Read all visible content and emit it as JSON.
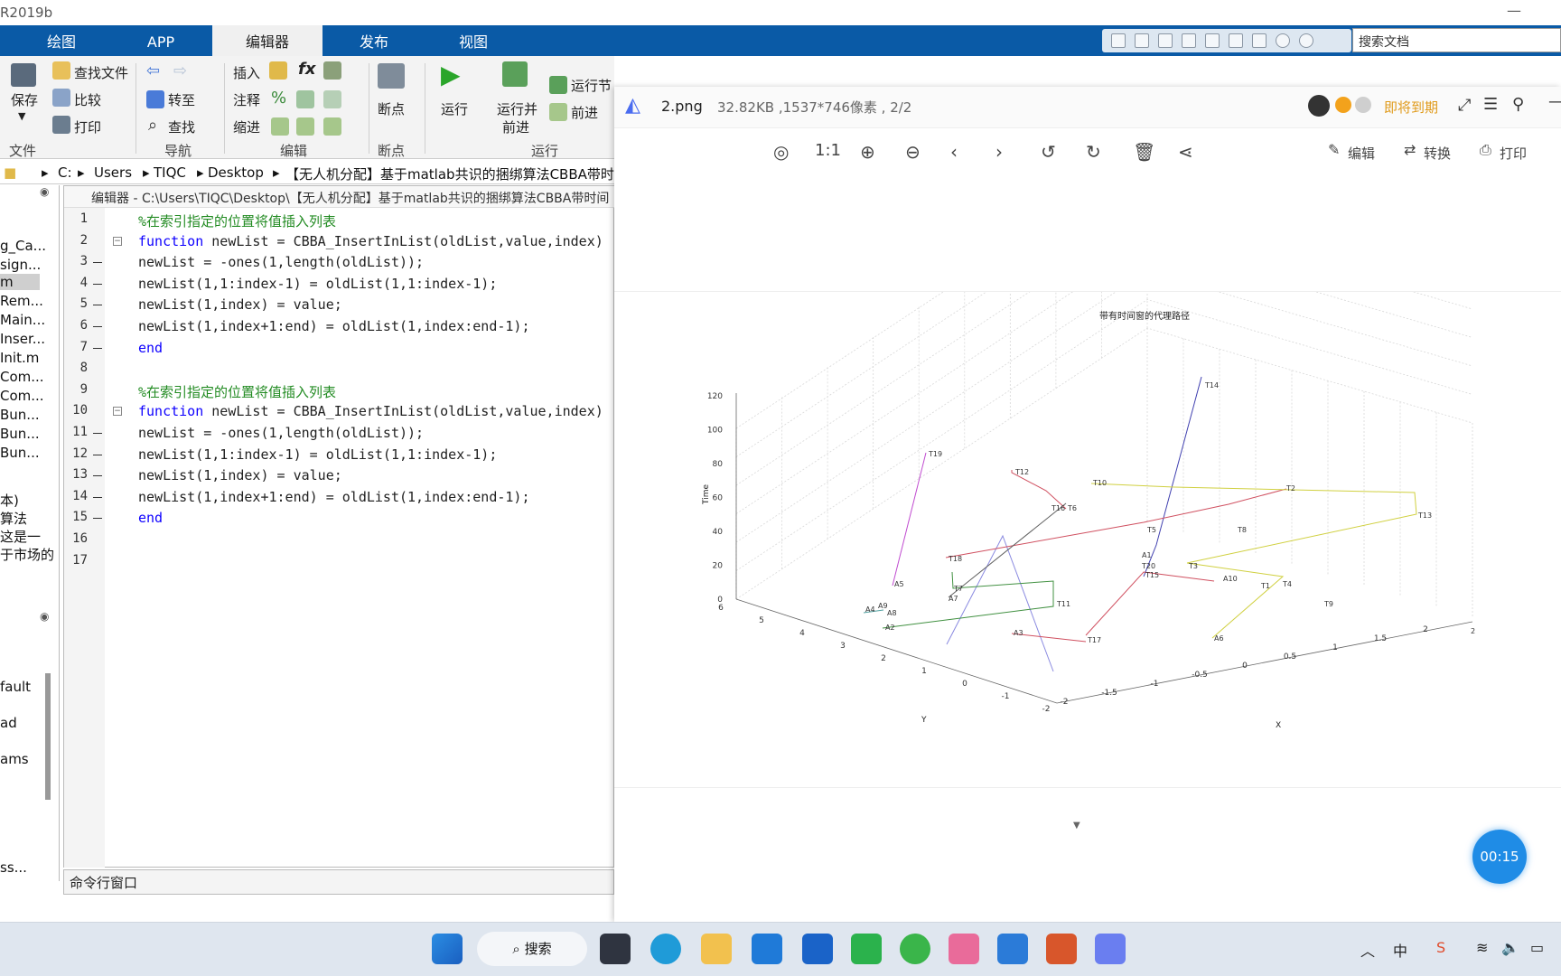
{
  "window": {
    "title_fragment": "R2019b"
  },
  "tabs": [
    "绘图",
    "APP",
    "编辑器",
    "发布",
    "视图"
  ],
  "search_doc_placeholder": "搜索文档",
  "ribbon": {
    "save": "保存",
    "find_file": "查找文件",
    "compare": "比较",
    "print": "打印",
    "goto": "转至",
    "find": "查找",
    "insert": "插入",
    "fx": "fx",
    "comment": "注释",
    "indent": "缩进",
    "breakpoints": "断点",
    "run": "运行",
    "run_advance_1": "运行并",
    "run_advance_2": "前进",
    "run_section": "运行节",
    "advance": "前进",
    "sections": {
      "file": "文件",
      "navigate": "导航",
      "edit": "编辑",
      "breakpoints": "断点",
      "run": "运行"
    }
  },
  "path": [
    "C:",
    "Users",
    "TIQC",
    "Desktop",
    "【无人机分配】基于matlab共识的捆绑算法CBBA带时间"
  ],
  "left_files": [
    "g_Ca...",
    "sign...",
    "m",
    "Rem...",
    "Main...",
    "Inser...",
    "Init.m",
    "Com...",
    "Com...",
    "Bun...",
    "Bun...",
    "Bun..."
  ],
  "left_details": [
    "本)",
    "算法",
    "这是一",
    "于市场的"
  ],
  "left_ws": [
    "fault",
    "ad",
    "ams",
    "ss..."
  ],
  "editor": {
    "header": "编辑器 - C:\\Users\\TIQC\\Desktop\\【无人机分配】基于matlab共识的捆绑算法CBBA带时间",
    "lines": [
      {
        "n": "1",
        "text": "%在索引指定的位置将值插入列表",
        "type": "comment"
      },
      {
        "n": "2",
        "text": "function newList = CBBA_InsertInList(oldList,value,index)",
        "type": "func"
      },
      {
        "n": "3",
        "text": "newList = -ones(1,length(oldList));",
        "type": "code"
      },
      {
        "n": "4",
        "text": "newList(1,1:index-1) = oldList(1,1:index-1);",
        "type": "code"
      },
      {
        "n": "5",
        "text": "newList(1,index) = value;",
        "type": "code"
      },
      {
        "n": "6",
        "text": "newList(1,index+1:end) = oldList(1,index:end-1);",
        "type": "code"
      },
      {
        "n": "7",
        "text": "end",
        "type": "end"
      },
      {
        "n": "8",
        "text": "",
        "type": "blank"
      },
      {
        "n": "9",
        "text": "%在索引指定的位置将值插入列表",
        "type": "comment"
      },
      {
        "n": "10",
        "text": "function newList = CBBA_InsertInList(oldList,value,index)",
        "type": "func"
      },
      {
        "n": "11",
        "text": "newList = -ones(1,length(oldList));",
        "type": "code"
      },
      {
        "n": "12",
        "text": "newList(1,1:index-1) = oldList(1,1:index-1);",
        "type": "code"
      },
      {
        "n": "13",
        "text": "newList(1,index) = value;",
        "type": "code"
      },
      {
        "n": "14",
        "text": "newList(1,index+1:end) = oldList(1,index:end-1);",
        "type": "code"
      },
      {
        "n": "15",
        "text": "end",
        "type": "end"
      },
      {
        "n": "16",
        "text": "",
        "type": "blank"
      },
      {
        "n": "17",
        "text": "",
        "type": "blank"
      }
    ]
  },
  "cmd_window": "命令行窗口",
  "viewer": {
    "filename": "2.png",
    "fileinfo": "32.82KB ,1537*746像素 , 2/2",
    "expiring": "即将到期",
    "zoom_1to1": "1:1",
    "edit": "编辑",
    "convert": "转换",
    "print": "打印",
    "timer": "00:15"
  },
  "plot": {
    "title": "带有时间窗的代理路径",
    "ylabel_z": "Time",
    "ylabel_y": "Y",
    "xlabel": "X",
    "z_ticks": [
      "0",
      "20",
      "40",
      "60",
      "80",
      "100",
      "120"
    ],
    "y_ticks": [
      "6",
      "5",
      "4",
      "3",
      "2",
      "1",
      "0",
      "-1",
      "-2"
    ],
    "x_ticks": [
      "-2",
      "-1.5",
      "-1",
      "-0.5",
      "0",
      "0.5",
      "1",
      "1.5",
      "2"
    ],
    "labels": [
      "T14",
      "T19",
      "T12",
      "T10",
      "T2",
      "T13",
      "T16",
      "T6",
      "T5",
      "T8",
      "T18",
      "A1",
      "T20",
      "T3",
      "T15",
      "A10",
      "T4",
      "T7",
      "A7",
      "T1",
      "A5",
      "T11",
      "T9",
      "A4",
      "A9",
      "A8",
      "A2",
      "A3",
      "T17",
      "A6",
      "2"
    ]
  },
  "taskbar": {
    "search": "搜索"
  }
}
